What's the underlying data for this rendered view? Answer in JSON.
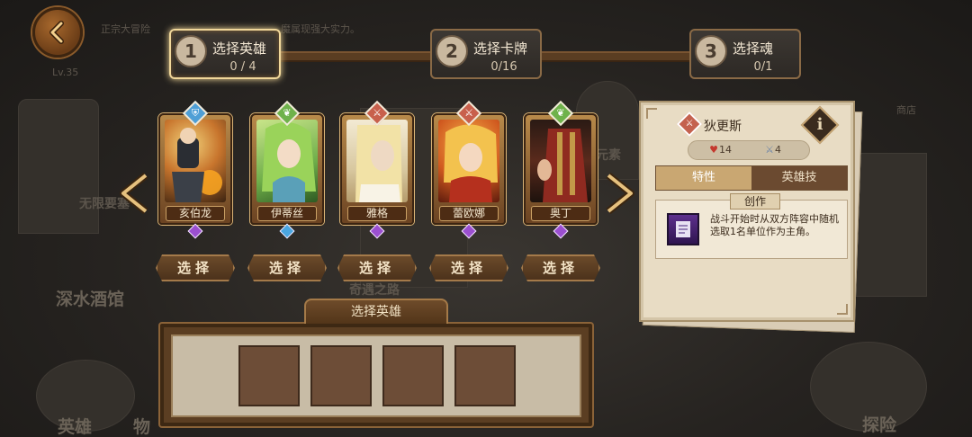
{
  "background": {
    "labels": [
      {
        "text": "正宗大冒险",
        "size": "small"
      },
      {
        "text": "魔属现强大实力。",
        "size": "small"
      },
      {
        "text": "Lv.35",
        "size": "small"
      },
      {
        "text": "无限要塞",
        "size": "normal"
      },
      {
        "text": "深水酒馆",
        "size": "big"
      },
      {
        "text": "奇遇之路",
        "size": "normal"
      },
      {
        "text": "元素",
        "size": "normal"
      },
      {
        "text": "英雄",
        "size": "big"
      },
      {
        "text": "物",
        "size": "big"
      },
      {
        "text": "探险",
        "size": "big"
      },
      {
        "text": "商店",
        "size": "small"
      }
    ]
  },
  "steps": [
    {
      "number": "1",
      "title": "选择英雄",
      "count": "0 / 4",
      "active": true
    },
    {
      "number": "2",
      "title": "选择卡牌",
      "count": "0/16",
      "active": false
    },
    {
      "number": "3",
      "title": "选择魂",
      "count": "0/1",
      "active": false
    }
  ],
  "heroes": [
    {
      "name": "亥伯龙",
      "class_icon": "shield-icon",
      "class_symbol": "⛨",
      "class_color": "#4f9fd6",
      "gem_color": "#9b4fd0"
    },
    {
      "name": "伊蒂丝",
      "class_icon": "leaf-icon",
      "class_symbol": "❦",
      "class_color": "#6fb24b",
      "gem_color": "#4aa6e0"
    },
    {
      "name": "雅格",
      "class_icon": "sword-icon",
      "class_symbol": "⚔",
      "class_color": "#c8604c",
      "gem_color": "#9b4fd0"
    },
    {
      "name": "蕾欧娜",
      "class_icon": "sword-icon",
      "class_symbol": "⚔",
      "class_color": "#c8604c",
      "gem_color": "#9b4fd0"
    },
    {
      "name": "奥丁",
      "class_icon": "leaf-icon",
      "class_symbol": "❦",
      "class_color": "#6fb24b",
      "gem_color": "#9b4fd0"
    }
  ],
  "select_label": "选择",
  "tray": {
    "title": "选择英雄",
    "slots": 4
  },
  "detail": {
    "hero_name": "狄更斯",
    "info_label": "i",
    "hp_icon": "heart-icon",
    "hp": "14",
    "atk_icon": "sword-icon",
    "atk": "4",
    "tabs": [
      "特性",
      "英雄技"
    ],
    "skill_name": "创作",
    "skill_icon": "scroll-icon",
    "skill_desc": "战斗开始时从双方阵容中随机选取1名单位作为主角。"
  },
  "colors": {
    "accent_gold": "#f0d79a",
    "panel_paper": "#e8dcc4",
    "brown_button": "#6b4a2a"
  }
}
